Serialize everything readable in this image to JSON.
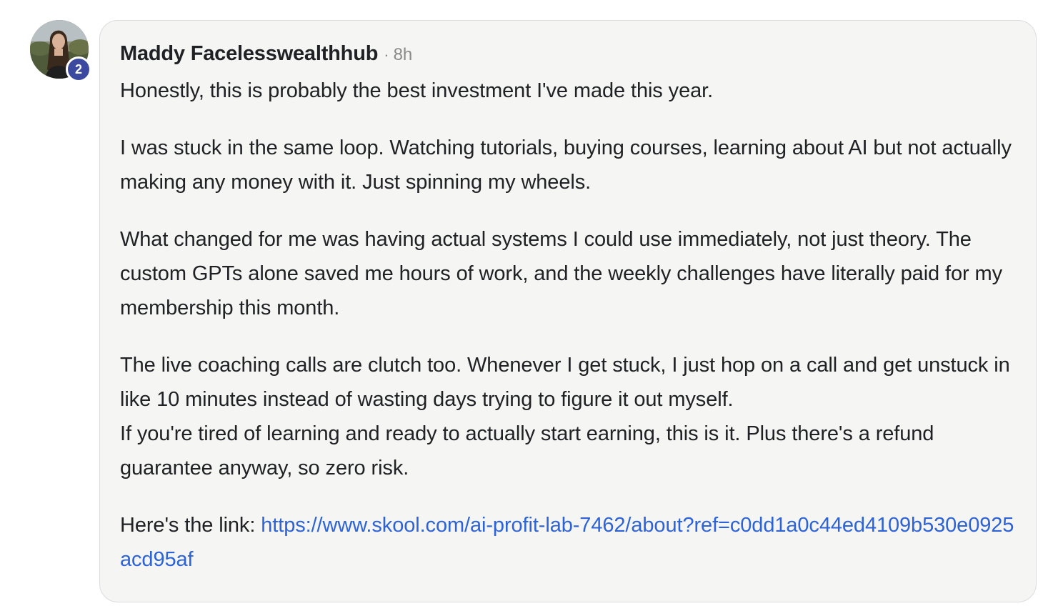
{
  "comment": {
    "author": "Maddy Facelesswealthhub",
    "separator": "·",
    "time": "8h",
    "level": "2",
    "paragraphs": [
      "Honestly, this is probably the best investment I've made this year.",
      "I was stuck in the same loop. Watching tutorials, buying courses, learning about AI but not actually making any money with it. Just spinning my wheels.",
      "What changed for me was having actual systems I could use immediately, not just theory. The custom GPTs alone saved me hours of work, and the weekly challenges have literally paid for my membership this month.",
      "The live coaching calls are clutch too. Whenever I get stuck, I just hop on a call and get unstuck in like 10 minutes instead of wasting days trying to figure it out myself.",
      "If you're tired of learning and ready to actually start earning, this is it. Plus there's a refund guarantee anyway, so zero risk."
    ],
    "link_prefix": "Here's the link: ",
    "link_url": "https://www.skool.com/ai-profit-lab-7462/about?ref=c0dd1a0c44ed4109b530e0925acd95af"
  },
  "colors": {
    "link": "#2c63d8",
    "badge": "#3b4a9e",
    "bubble_bg": "#f5f5f4",
    "meta": "#8a8a8a"
  }
}
